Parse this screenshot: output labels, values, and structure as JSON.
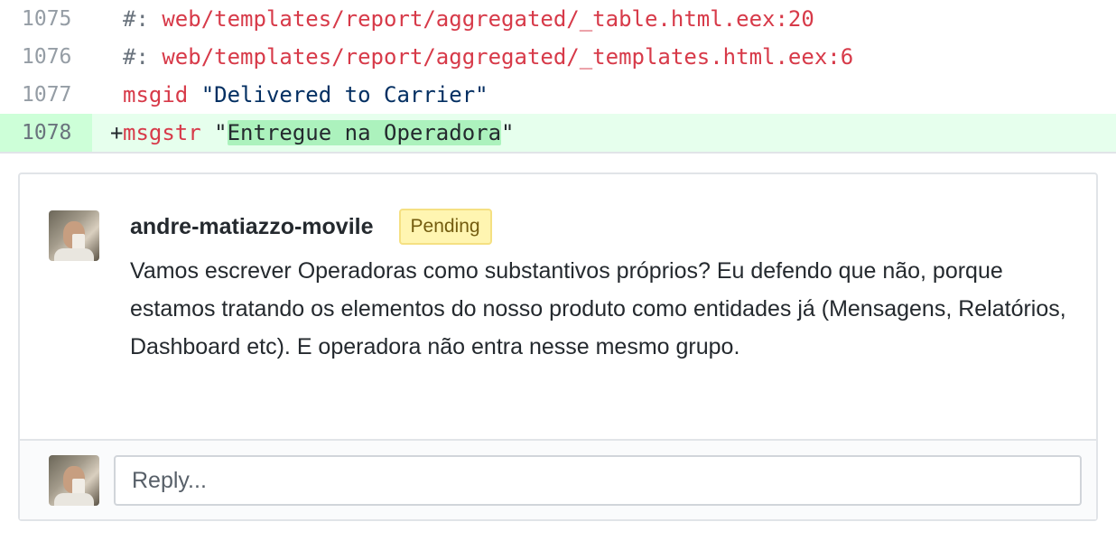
{
  "diff": {
    "lines": [
      {
        "num": "1075",
        "prefix": "#:",
        "text": "web/templates/report/aggregated/_table.html.eex:20"
      },
      {
        "num": "1076",
        "prefix": "#:",
        "text": "web/templates/report/aggregated/_templates.html.eex:6"
      },
      {
        "num": "1077",
        "keyword": "msgid",
        "string": "\"Delivered to Carrier\""
      },
      {
        "num": "1078",
        "marker": "+",
        "keyword": "msgstr",
        "quote_open": "\"",
        "highlighted": "Entregue na Operadora",
        "quote_close": "\""
      }
    ]
  },
  "comment": {
    "author": "andre-matiazzo-movile",
    "badge": "Pending",
    "body": "Vamos escrever Operadoras como substantivos próprios? Eu defendo que não, porque estamos tratando os elementos do nosso produto como entidades já (Mensagens, Relatórios, Dashboard etc). E operadora não entra nesse mesmo grupo."
  },
  "reply": {
    "placeholder": "Reply..."
  }
}
